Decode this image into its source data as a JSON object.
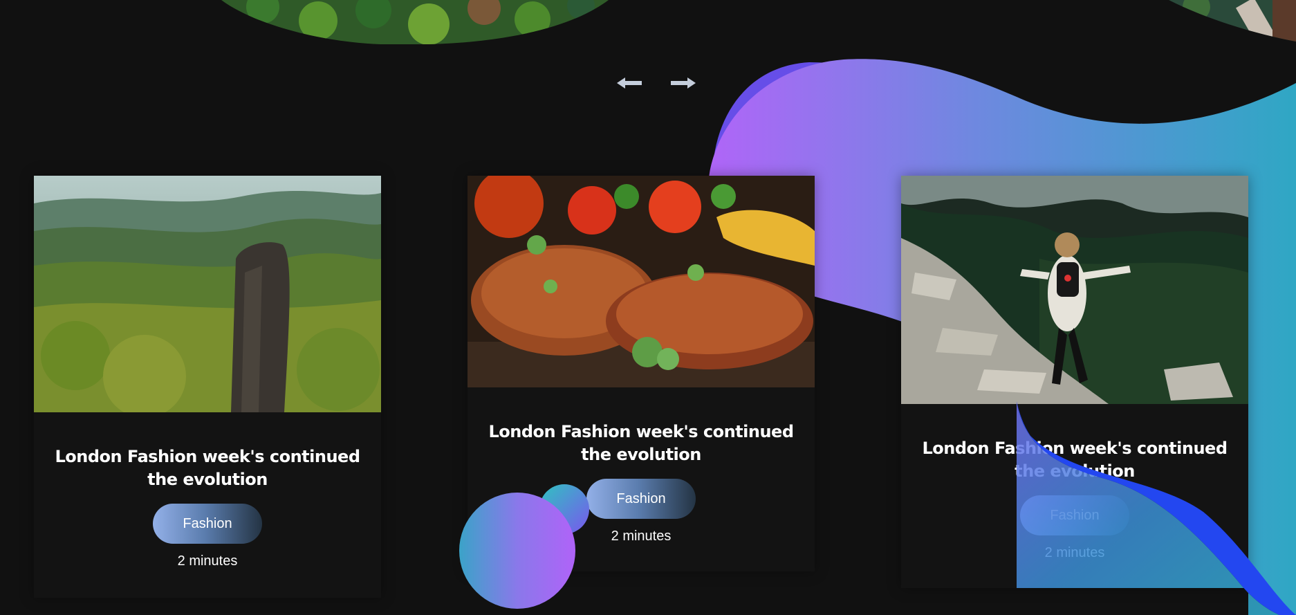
{
  "carousel": {
    "prev_icon": "arrow-left-icon",
    "next_icon": "arrow-right-icon",
    "arrow_color": "#c5cedc"
  },
  "colors": {
    "background": "#111111",
    "card_background": "#131313",
    "blob_gradient_start": "#b065f8",
    "blob_gradient_mid": "#6f88e0",
    "blob_gradient_end": "#2fa7c4",
    "accent_blue": "#2347f0",
    "tag_gradient_start": "#93b0e8",
    "tag_gradient_end": "#243444"
  },
  "cards": [
    {
      "image": "forest-rock-pillar-photo",
      "title": "London Fashion week's continued the evolution",
      "tag": "Fashion",
      "read_time": "2 minutes"
    },
    {
      "image": "grilled-steaks-photo",
      "title": "London Fashion week's continued the evolution",
      "tag": "Fashion",
      "read_time": "2 minutes"
    },
    {
      "image": "mountain-hiker-photo",
      "title": "London Fashion week's continued the evolution",
      "tag": "Fashion",
      "read_time": "2 minutes"
    }
  ]
}
